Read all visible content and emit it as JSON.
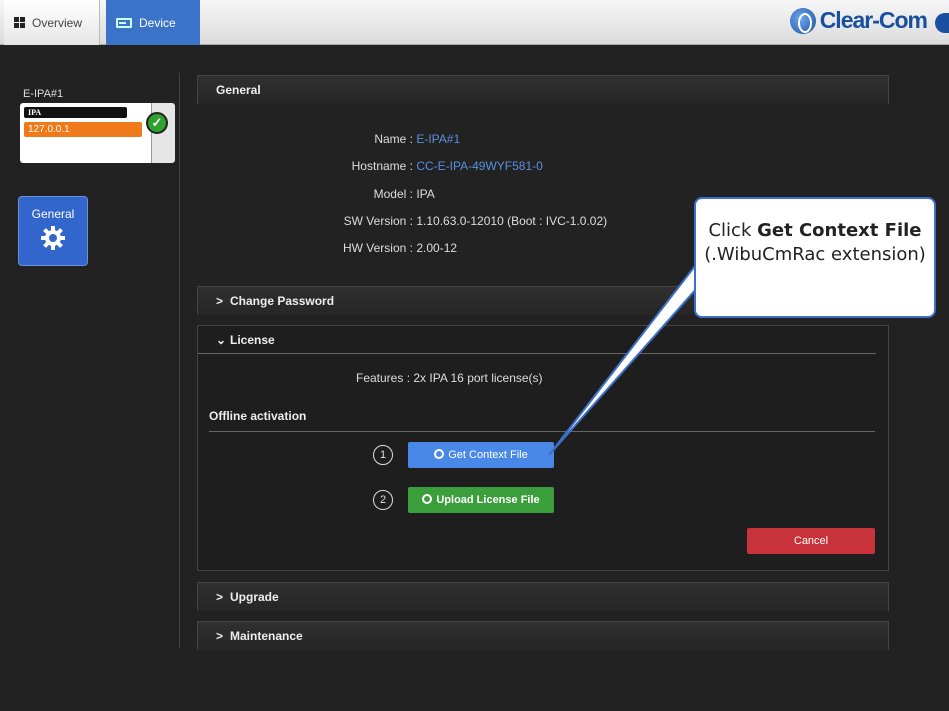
{
  "topbar": {
    "tabs": [
      {
        "label": "Overview"
      },
      {
        "label": "Device"
      }
    ],
    "brand": "Clear-Com"
  },
  "left_panel": {
    "device_name": "E-IPA#1",
    "device_model": "IPA",
    "device_ip": "127.0.0.1",
    "general_tile_label": "General"
  },
  "general": {
    "heading": "General",
    "rows": [
      {
        "key": "Name :",
        "value": "E-IPA#1"
      },
      {
        "key": "Hostname :",
        "value": "CC-E-IPA-49WYF581-0"
      },
      {
        "key": "Model :",
        "value": "IPA"
      },
      {
        "key": "SW Version :",
        "value": "1.10.63.0-12010 (Boot : IVC-1.0.02)"
      },
      {
        "key": "HW Version :",
        "value": "2.00-12"
      }
    ]
  },
  "change_password": {
    "heading": "Change Password"
  },
  "license": {
    "heading": "License",
    "features_key": "Features :",
    "features_value": "2x IPA 16 port license(s)",
    "offline_title": "Offline activation",
    "step1": "1",
    "step2": "2",
    "get_context_label": "Get Context File",
    "upload_license_label": "Upload License File",
    "cancel_label": "Cancel"
  },
  "upgrade": {
    "heading": "Upgrade"
  },
  "maintenance": {
    "heading": "Maintenance"
  },
  "callout": {
    "prefix": "Click ",
    "bold": "Get Context File",
    "suffix": " (.WibuCmRac extension)"
  }
}
